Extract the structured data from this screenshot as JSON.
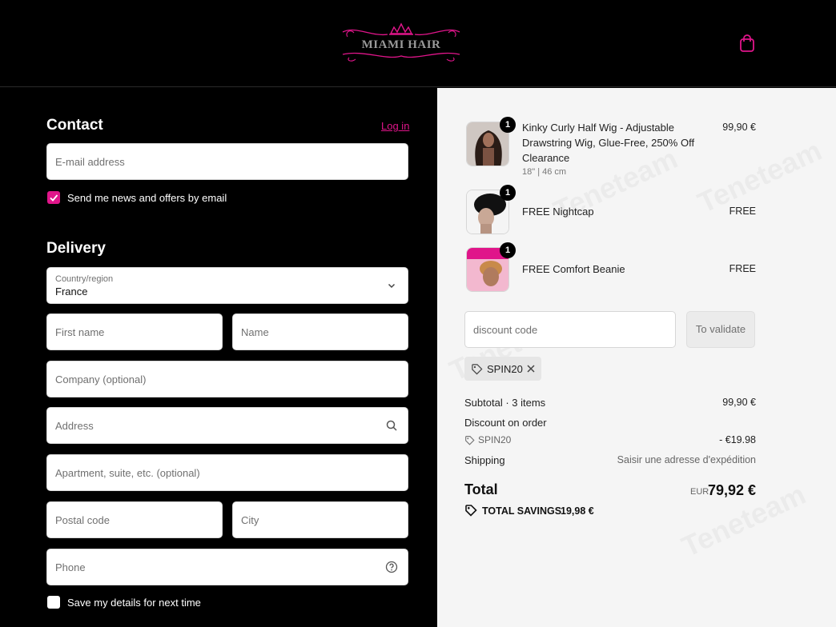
{
  "header": {
    "logo_text": "MIAMI HAIR",
    "cart_icon": "shopping-bag-icon",
    "accent_color": "#e0158a"
  },
  "contact": {
    "title": "Contact",
    "login_label": "Log in",
    "email_placeholder": "E-mail address",
    "news_checkbox_label": "Send me news and offers by email",
    "news_checked": true
  },
  "delivery": {
    "title": "Delivery",
    "country_label": "Country/region",
    "country_value": "France",
    "first_name_placeholder": "First name",
    "last_name_placeholder": "Name",
    "company_placeholder": "Company (optional)",
    "address_placeholder": "Address",
    "apartment_placeholder": "Apartment, suite, etc. (optional)",
    "postal_placeholder": "Postal code",
    "city_placeholder": "City",
    "phone_placeholder": "Phone",
    "save_checkbox_label": "Save my details for next time",
    "save_checked": false
  },
  "order": {
    "items": [
      {
        "title": "Kinky Curly Half Wig - Adjustable Drawstring Wig, Glue-Free, 250% Off Clearance",
        "variant": "18\" | 46 cm",
        "price": "99,90 €",
        "qty": "1"
      },
      {
        "title": "FREE Nightcap",
        "price": "FREE",
        "qty": "1"
      },
      {
        "title": "FREE Comfort Beanie",
        "price": "FREE",
        "qty": "1"
      }
    ],
    "discount_placeholder": "discount code",
    "validate_label": "To validate",
    "applied_code": "SPIN20",
    "summary": {
      "subtotal_label": "Subtotal · 3 items",
      "subtotal_value": "99,90 €",
      "discount_label": "Discount on order",
      "discount_code": "SPIN20",
      "discount_value": "- €19.98",
      "shipping_label": "Shipping",
      "shipping_value": "Saisir une adresse d'expédition",
      "total_label": "Total",
      "currency": "EUR",
      "total_value": "79,92 €",
      "savings_label": "TOTAL SAVINGS",
      "savings_value": "19,98 €"
    },
    "watermark_text": "Teneteam"
  }
}
